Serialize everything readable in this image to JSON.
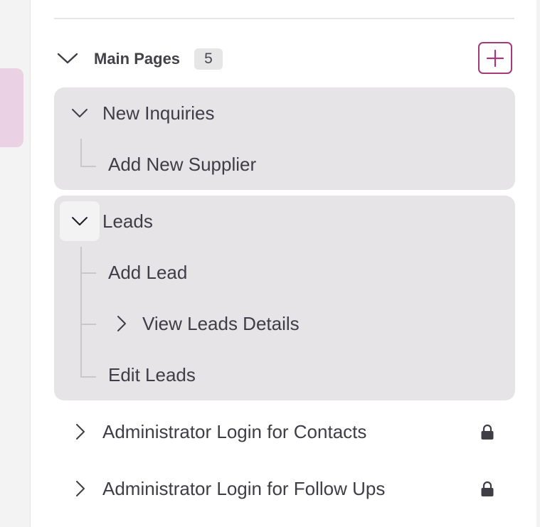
{
  "section": {
    "title": "Main Pages",
    "count": "5"
  },
  "groups": [
    {
      "label": "New Inquiries",
      "expanded": true,
      "children": [
        {
          "label": "Add New Supplier"
        }
      ]
    },
    {
      "label": "Leads",
      "expanded": true,
      "children": [
        {
          "label": "Add Lead"
        },
        {
          "label": "View Leads Details",
          "has_children": true
        },
        {
          "label": "Edit Leads"
        }
      ]
    }
  ],
  "locked_items": [
    {
      "label": "Administrator Login for Contacts",
      "icon": "lock-icon"
    },
    {
      "label": "Administrator Login for Follow Ups",
      "icon": "lock-icon"
    }
  ],
  "colors": {
    "accent": "#a53a7a",
    "rail_highlight": "#ead1e4",
    "group_bg": "#e6e4e6"
  }
}
